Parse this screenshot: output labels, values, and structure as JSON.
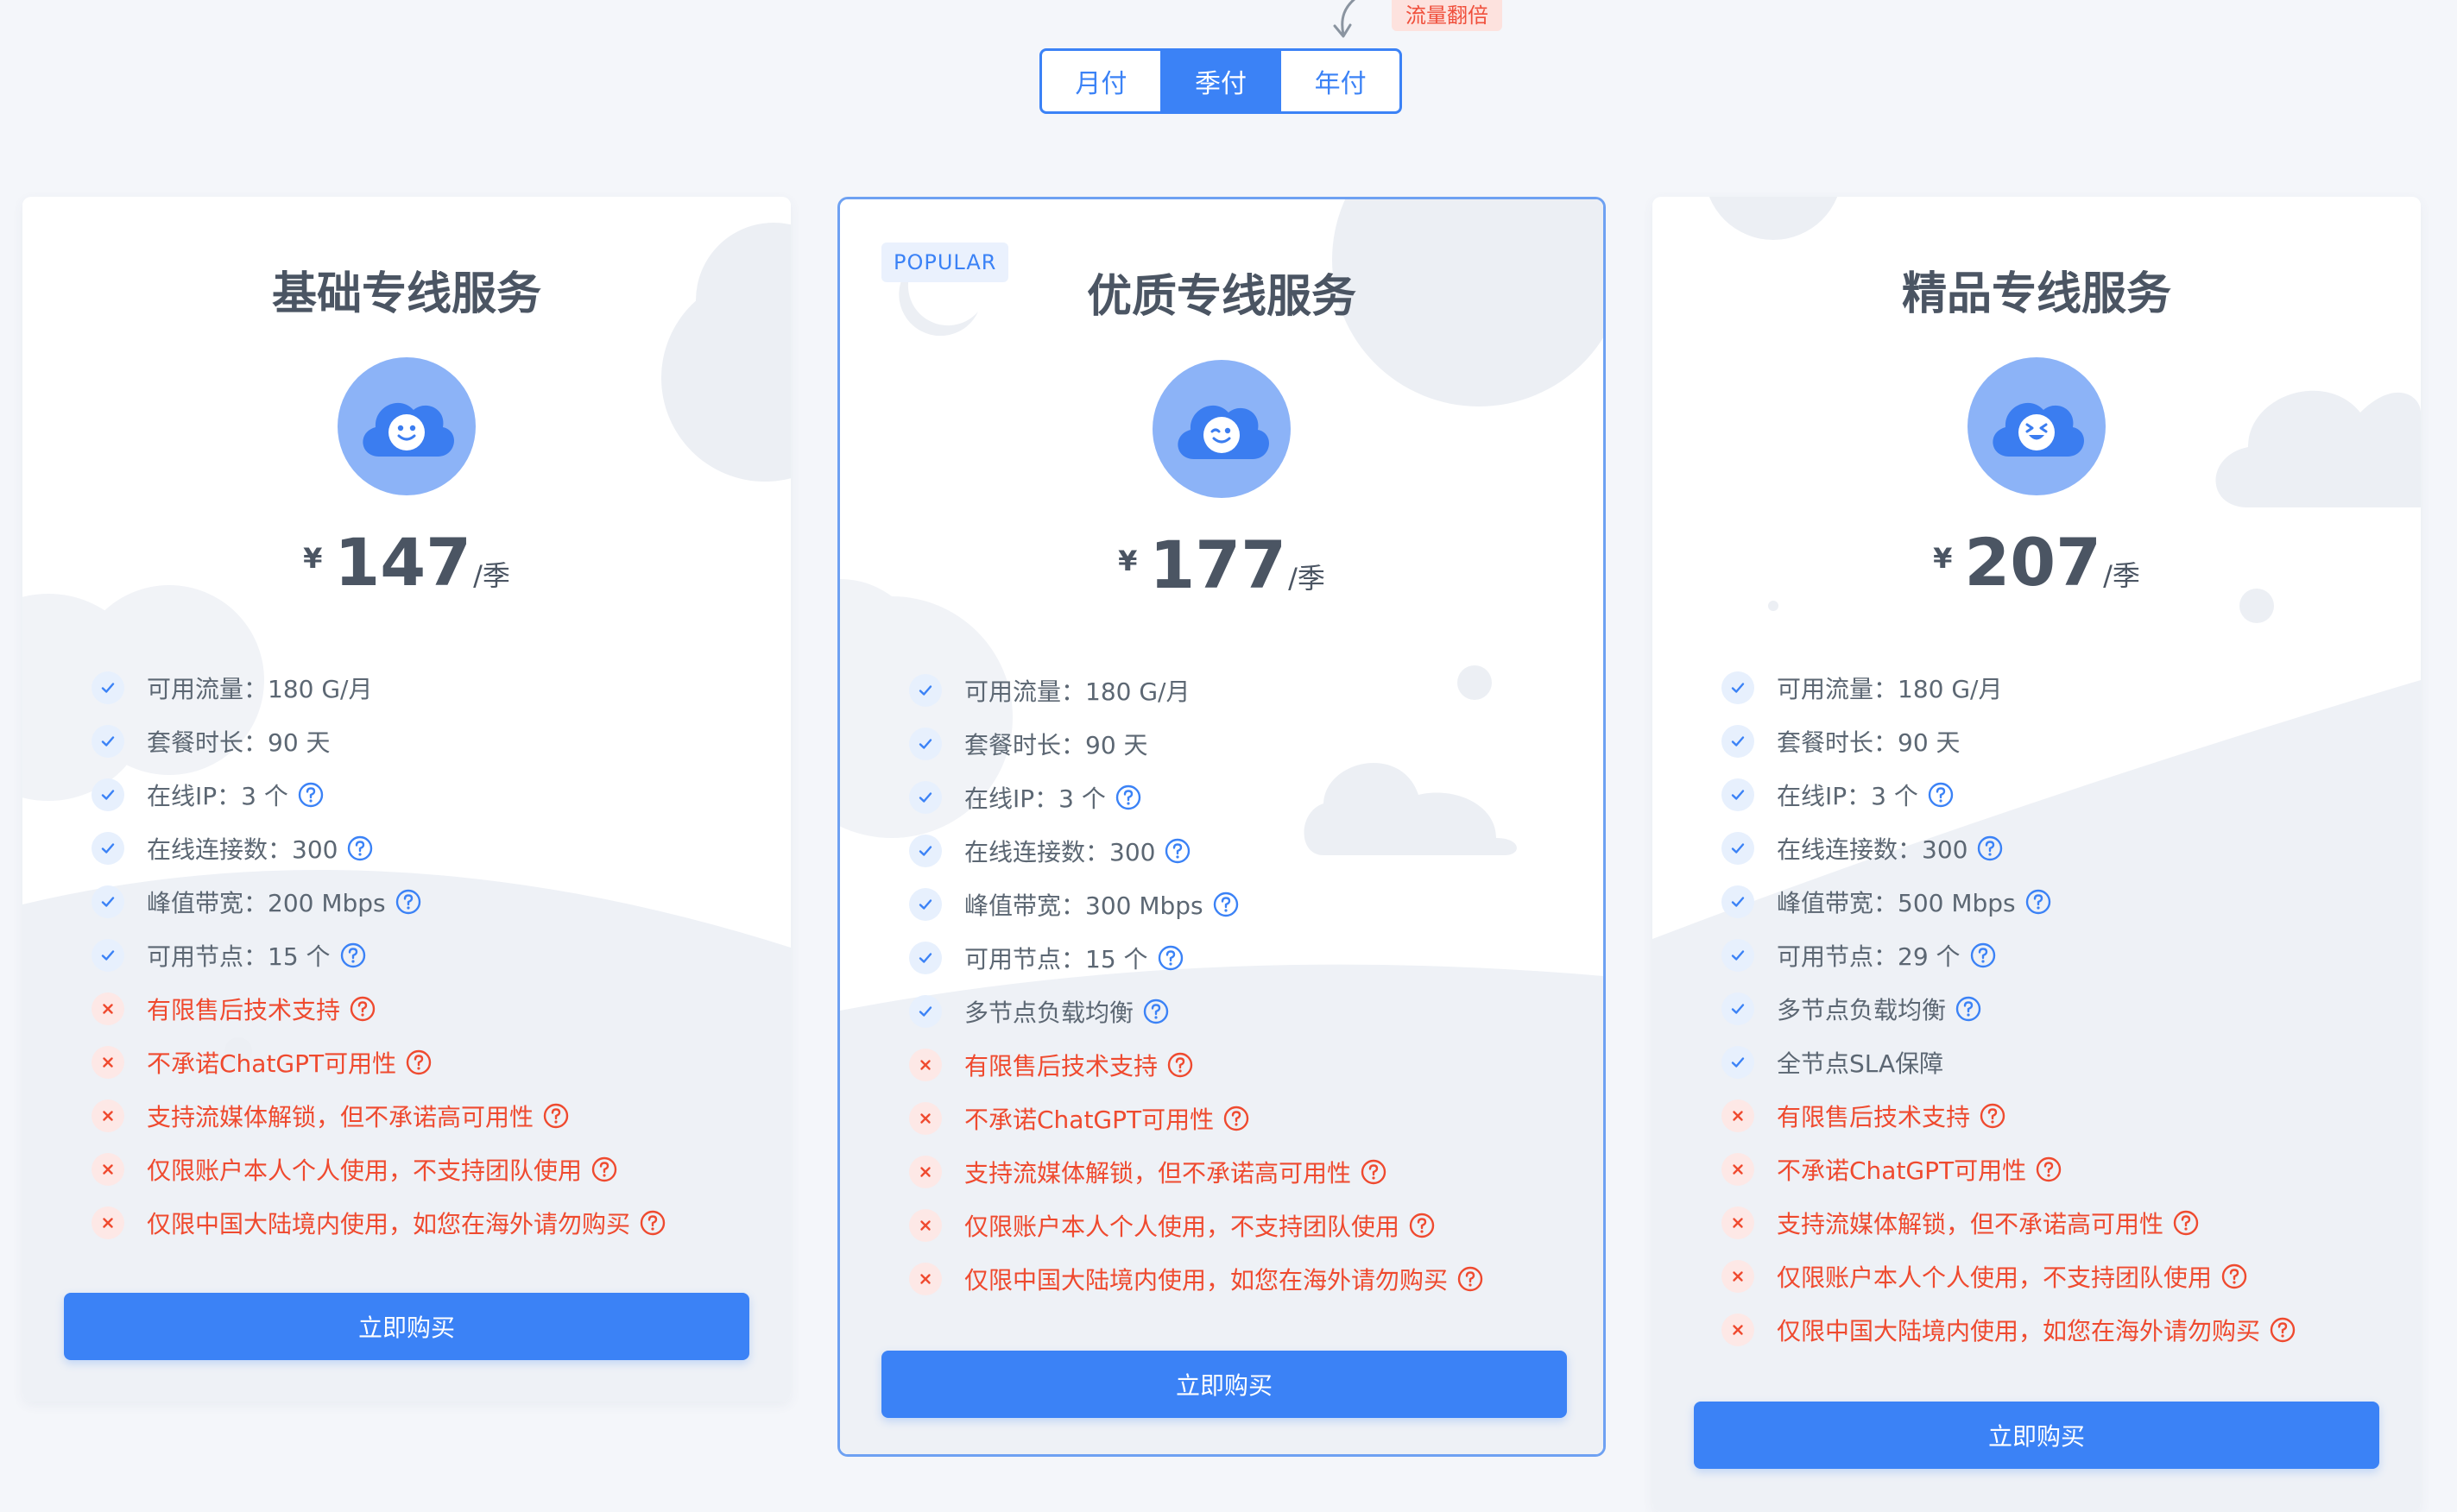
{
  "billing": {
    "options": [
      "月付",
      "季付",
      "年付"
    ],
    "selected": "季付",
    "badge": "流量翻倍"
  },
  "colors": {
    "accent": "#3b82f6",
    "negative": "#ef4a2f",
    "text": "#5c6773",
    "avatar": "#8cb3f7"
  },
  "plans": [
    {
      "title": "基础专线服务",
      "currency": "¥",
      "price": "147",
      "period": "/季",
      "face": "smile",
      "features": [
        {
          "text": "可用流量：180 G/月",
          "ok": true,
          "help": false
        },
        {
          "text": "套餐时长：90 天",
          "ok": true,
          "help": false
        },
        {
          "text": "在线IP：3 个",
          "ok": true,
          "help": true
        },
        {
          "text": "在线连接数：300",
          "ok": true,
          "help": true
        },
        {
          "text": "峰值带宽：200 Mbps",
          "ok": true,
          "help": true
        },
        {
          "text": "可用节点：15 个",
          "ok": true,
          "help": true
        },
        {
          "text": "有限售后技术支持",
          "ok": false,
          "help": true
        },
        {
          "text": "不承诺ChatGPT可用性",
          "ok": false,
          "help": true
        },
        {
          "text": "支持流媒体解锁，但不承诺高可用性",
          "ok": false,
          "help": true
        },
        {
          "text": "仅限账户本人个人使用，不支持团队使用",
          "ok": false,
          "help": true
        },
        {
          "text": "仅限中国大陆境内使用，如您在海外请勿购买",
          "ok": false,
          "help": true
        }
      ],
      "button": "立即购买"
    },
    {
      "title": "优质专线服务",
      "tag": "POPULAR",
      "currency": "¥",
      "price": "177",
      "period": "/季",
      "face": "wink",
      "features": [
        {
          "text": "可用流量：180 G/月",
          "ok": true,
          "help": false
        },
        {
          "text": "套餐时长：90 天",
          "ok": true,
          "help": false
        },
        {
          "text": "在线IP：3 个",
          "ok": true,
          "help": true
        },
        {
          "text": "在线连接数：300",
          "ok": true,
          "help": true
        },
        {
          "text": "峰值带宽：300 Mbps",
          "ok": true,
          "help": true
        },
        {
          "text": "可用节点：15 个",
          "ok": true,
          "help": true
        },
        {
          "text": "多节点负载均衡",
          "ok": true,
          "help": true
        },
        {
          "text": "有限售后技术支持",
          "ok": false,
          "help": true
        },
        {
          "text": "不承诺ChatGPT可用性",
          "ok": false,
          "help": true
        },
        {
          "text": "支持流媒体解锁，但不承诺高可用性",
          "ok": false,
          "help": true
        },
        {
          "text": "仅限账户本人个人使用，不支持团队使用",
          "ok": false,
          "help": true
        },
        {
          "text": "仅限中国大陆境内使用，如您在海外请勿购买",
          "ok": false,
          "help": true
        }
      ],
      "button": "立即购买"
    },
    {
      "title": "精品专线服务",
      "currency": "¥",
      "price": "207",
      "period": "/季",
      "face": "laugh",
      "features": [
        {
          "text": "可用流量：180 G/月",
          "ok": true,
          "help": false
        },
        {
          "text": "套餐时长：90 天",
          "ok": true,
          "help": false
        },
        {
          "text": "在线IP：3 个",
          "ok": true,
          "help": true
        },
        {
          "text": "在线连接数：300",
          "ok": true,
          "help": true
        },
        {
          "text": "峰值带宽：500 Mbps",
          "ok": true,
          "help": true
        },
        {
          "text": "可用节点：29 个",
          "ok": true,
          "help": true
        },
        {
          "text": "多节点负载均衡",
          "ok": true,
          "help": true
        },
        {
          "text": "全节点SLA保障",
          "ok": true,
          "help": false
        },
        {
          "text": "有限售后技术支持",
          "ok": false,
          "help": true
        },
        {
          "text": "不承诺ChatGPT可用性",
          "ok": false,
          "help": true
        },
        {
          "text": "支持流媒体解锁，但不承诺高可用性",
          "ok": false,
          "help": true
        },
        {
          "text": "仅限账户本人个人使用，不支持团队使用",
          "ok": false,
          "help": true
        },
        {
          "text": "仅限中国大陆境内使用，如您在海外请勿购买",
          "ok": false,
          "help": true
        }
      ],
      "button": "立即购买"
    }
  ]
}
